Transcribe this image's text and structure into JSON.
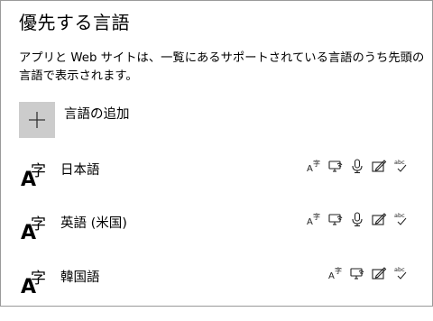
{
  "page": {
    "title": "優先する言語",
    "description": "アプリと Web サイトは、一覧にあるサポートされている言語のうち先頭の言語で表示されます。"
  },
  "add_language": {
    "label": "言語の追加",
    "icon": "plus-icon"
  },
  "languages": [
    {
      "name": "日本語",
      "glyph_latin": "A",
      "glyph_cjk": "字",
      "features": [
        "display-language-icon",
        "text-to-speech-icon",
        "speech-recognition-icon",
        "handwriting-icon",
        "spell-check-icon"
      ]
    },
    {
      "name": "英語 (米国)",
      "glyph_latin": "A",
      "glyph_cjk": "字",
      "features": [
        "display-language-icon",
        "text-to-speech-icon",
        "speech-recognition-icon",
        "handwriting-icon",
        "spell-check-icon"
      ]
    },
    {
      "name": "韓国語",
      "glyph_latin": "A",
      "glyph_cjk": "字",
      "features": [
        "display-language-icon",
        "text-to-speech-icon",
        "handwriting-icon",
        "spell-check-icon"
      ]
    }
  ],
  "colors": {
    "add_button_bg": "#cccccc",
    "border": "#9a9a9a",
    "text": "#000000"
  }
}
